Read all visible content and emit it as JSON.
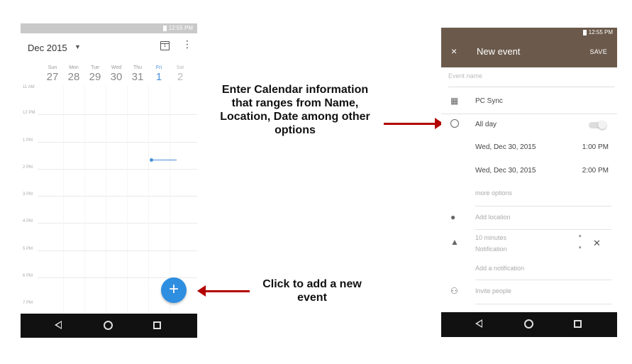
{
  "calendar": {
    "status_time": "12:55 PM",
    "month": "Dec 2015",
    "today_icon_num": "1",
    "days": [
      {
        "name": "Sun",
        "num": "27"
      },
      {
        "name": "Mon",
        "num": "28"
      },
      {
        "name": "Tue",
        "num": "29"
      },
      {
        "name": "Wed",
        "num": "30"
      },
      {
        "name": "Thu",
        "num": "31"
      },
      {
        "name": "Fri",
        "num": "1"
      },
      {
        "name": "Sat",
        "num": "2"
      }
    ],
    "hours": [
      "11 AM",
      "12 PM",
      "1 PM",
      "2 PM",
      "3 PM",
      "4 PM",
      "5 PM",
      "6 PM",
      "7 PM"
    ],
    "fab_label": "+"
  },
  "annotations": {
    "edit_info": "Enter Calendar information that ranges from Name, Location, Date among other options",
    "add_event": "Click to add a new event"
  },
  "new_event": {
    "status_time": "12:55 PM",
    "title": "New event",
    "save_label": "SAVE",
    "close_icon": "×",
    "event_name_placeholder": "Event name",
    "calendar_account": "PC Sync",
    "all_day_label": "All day",
    "start_date": "Wed, Dec 30, 2015",
    "start_time": "1:00 PM",
    "end_date": "Wed, Dec 30, 2015",
    "end_time": "2:00 PM",
    "more_options": "more options",
    "location_placeholder": "Add location",
    "notification_time": "10 minutes",
    "notification_type": "Notification",
    "add_notification": "Add a notification",
    "invite_people": "Invite people"
  }
}
